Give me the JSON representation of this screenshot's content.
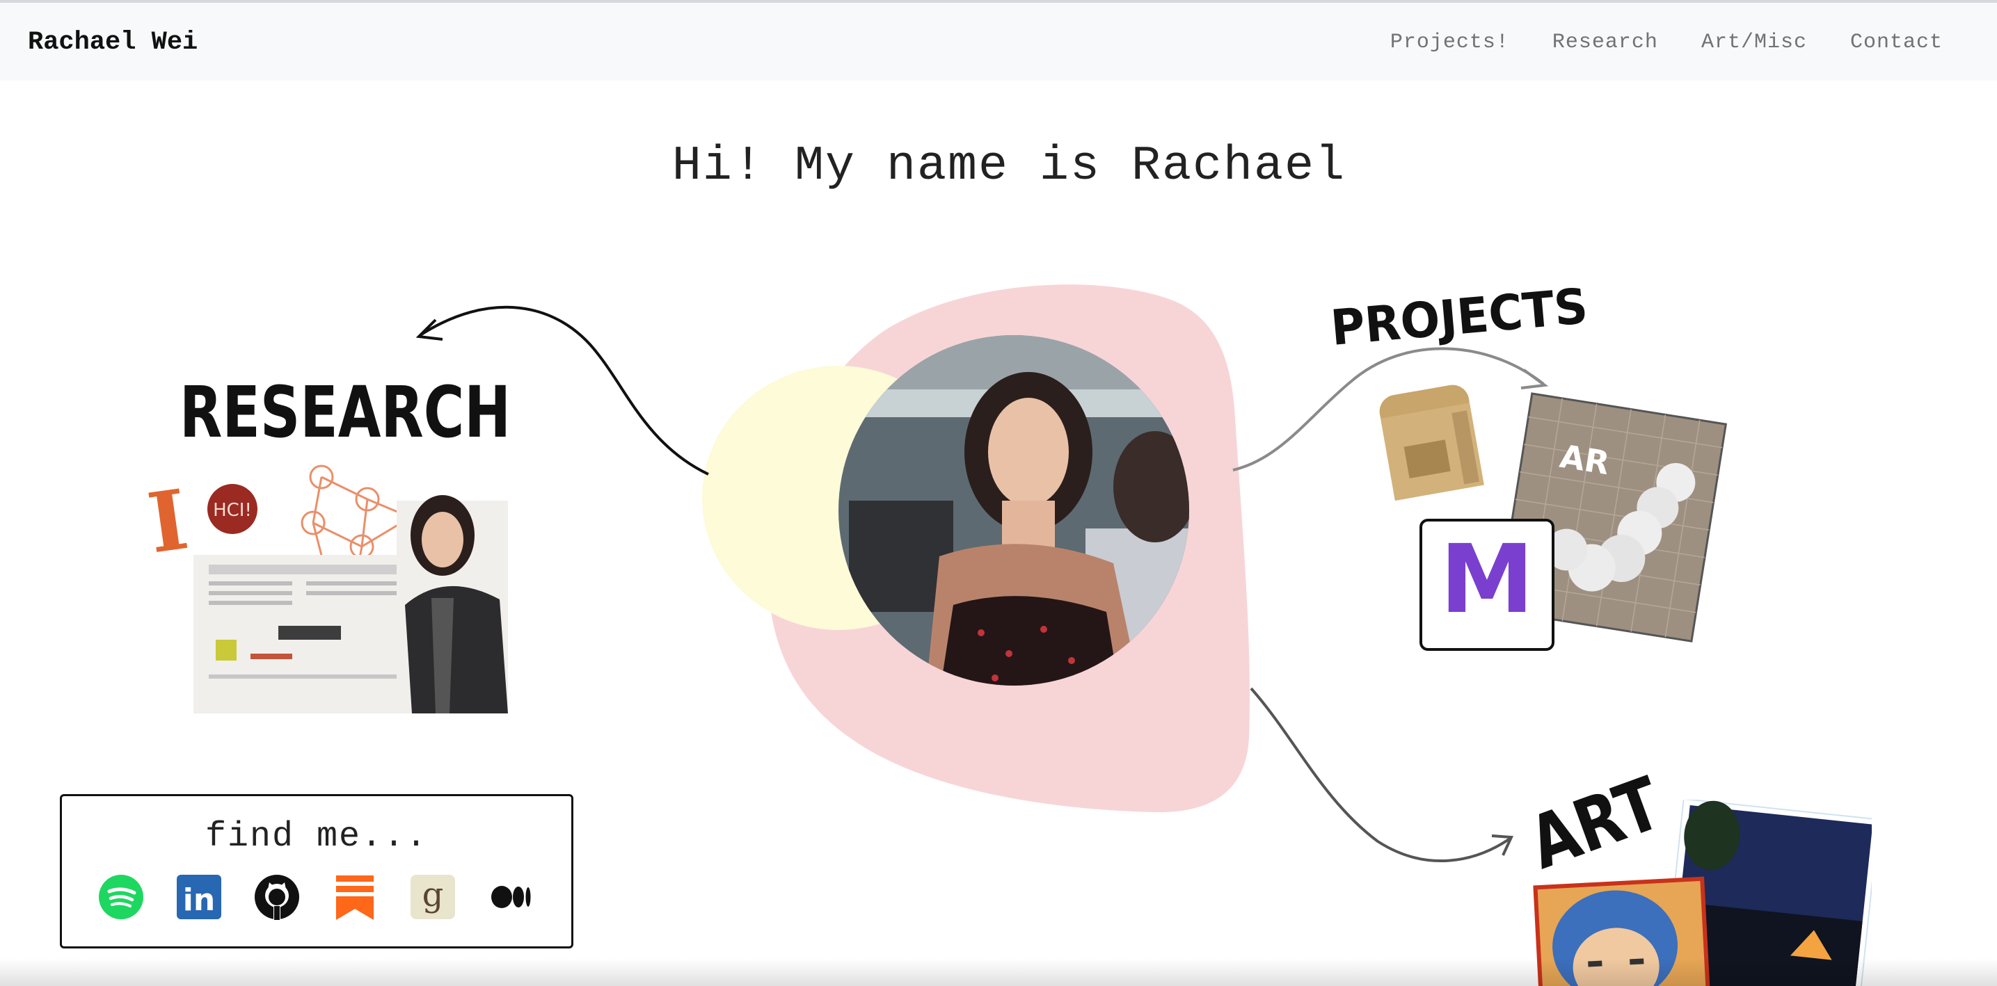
{
  "nav": {
    "brand": "Rachael Wei",
    "links": [
      "Projects!",
      "Research",
      "Art/Misc",
      "Contact"
    ]
  },
  "hero": {
    "title": "Hi! My name is Rachael"
  },
  "sections": {
    "research": "RESEARCH",
    "projects": "PROJECTS",
    "art": "ART"
  },
  "images": {
    "research_logo_letter": "I",
    "research_badge": "HCI!",
    "project_ar_label": "AR",
    "project_m_letter": "M"
  },
  "findme": {
    "title": "find me...",
    "icons": [
      "spotify-icon",
      "linkedin-icon",
      "github-icon",
      "substack-icon",
      "goodreads-icon",
      "medium-icon"
    ],
    "linkedin_text": "in",
    "goodreads_text": "g"
  },
  "colors": {
    "blob_pink": "#f7d5d7",
    "blob_yellow": "#fdfbd8",
    "accent_orange": "#e8743b",
    "spotify_green": "#1ed760",
    "linkedin_blue": "#2867b2",
    "m_purple": "#7b3fcf"
  }
}
